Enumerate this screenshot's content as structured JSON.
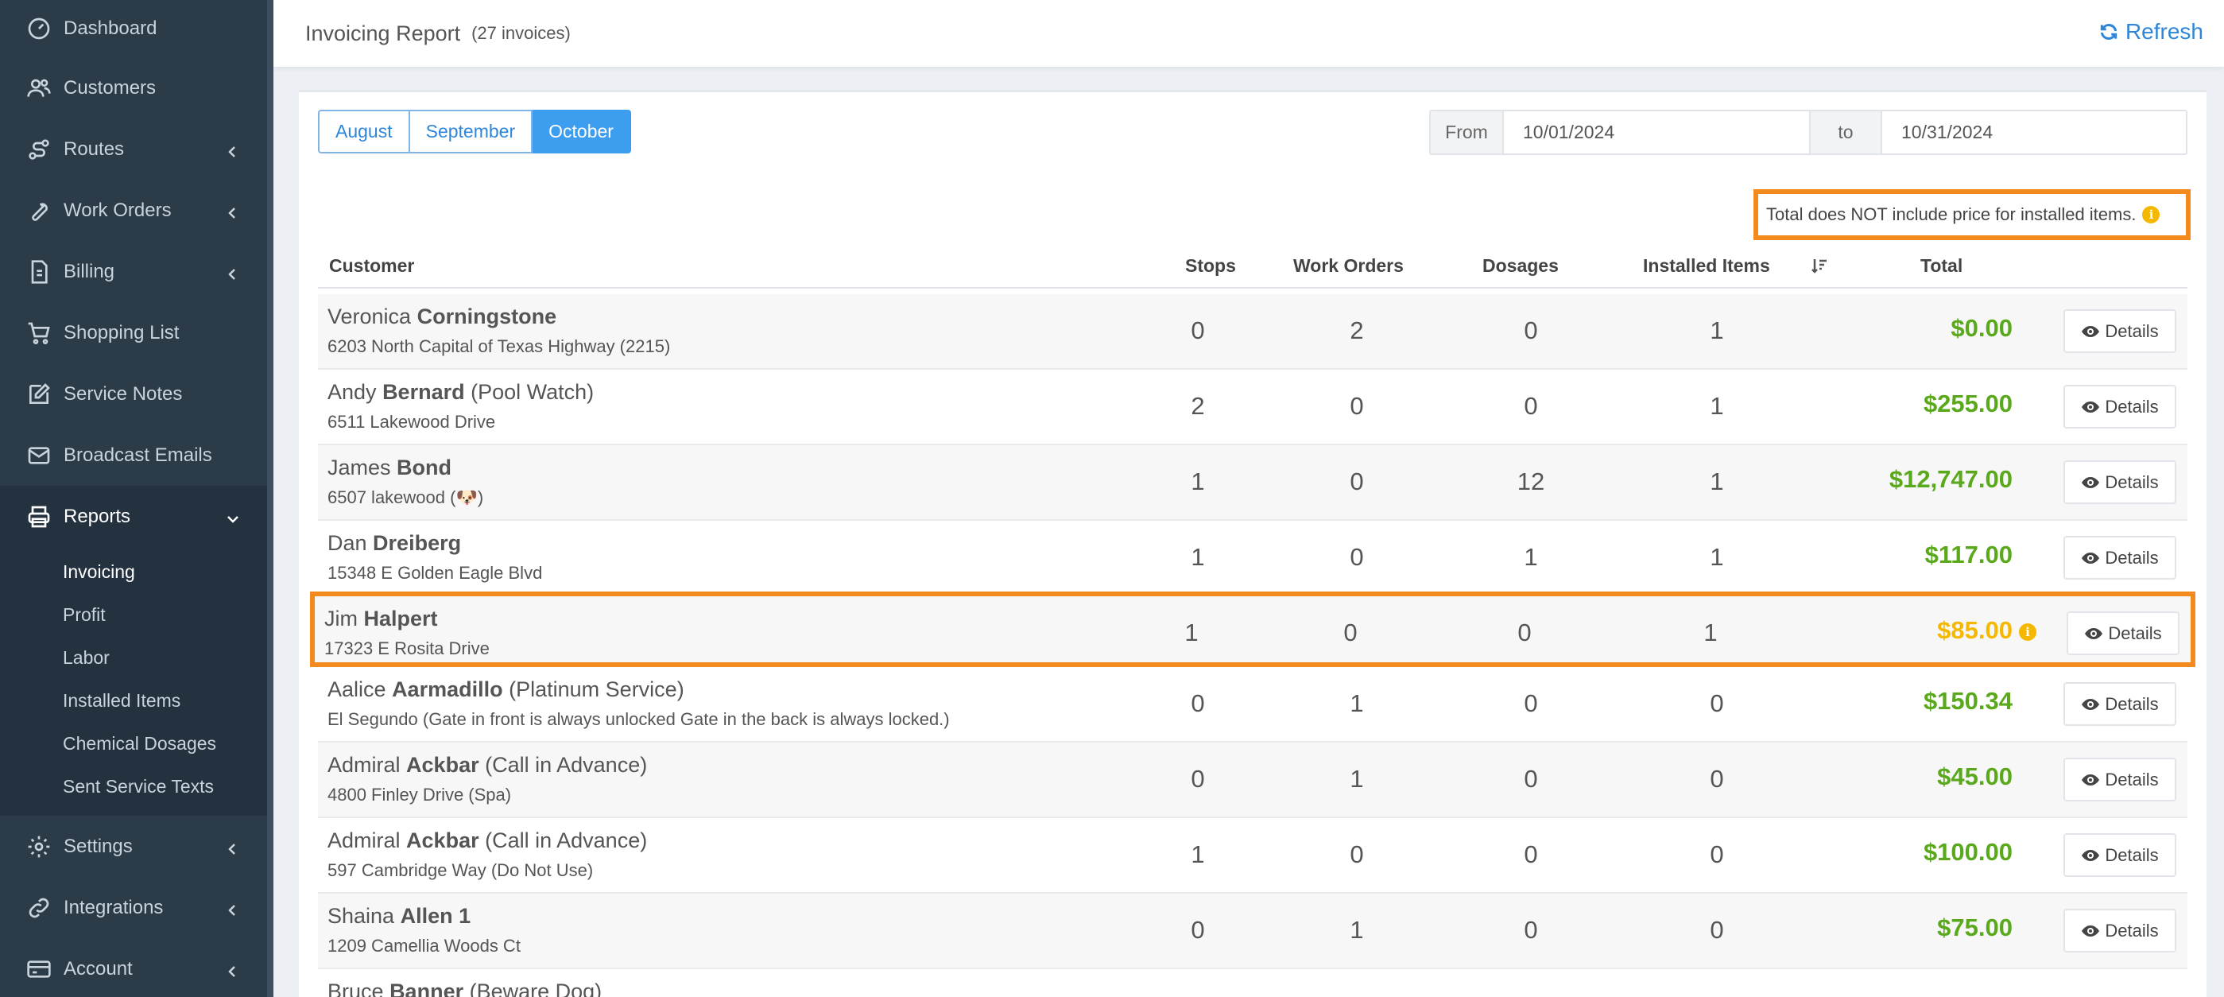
{
  "sidebar": {
    "items": [
      {
        "label": "Dashboard",
        "icon": "dashboard-icon"
      },
      {
        "label": "Customers",
        "icon": "users-icon"
      },
      {
        "label": "Routes",
        "icon": "route-icon"
      },
      {
        "label": "Work Orders",
        "icon": "wrench-icon"
      },
      {
        "label": "Billing",
        "icon": "invoice-icon"
      },
      {
        "label": "Shopping List",
        "icon": "cart-icon"
      },
      {
        "label": "Service Notes",
        "icon": "edit-icon"
      },
      {
        "label": "Broadcast Emails",
        "icon": "envelope-icon"
      },
      {
        "label": "Reports",
        "icon": "printer-icon"
      },
      {
        "label": "Settings",
        "icon": "gear-icon"
      },
      {
        "label": "Integrations",
        "icon": "link-icon"
      },
      {
        "label": "Account",
        "icon": "card-icon"
      }
    ],
    "reports_sub": [
      "Invoicing",
      "Profit",
      "Labor",
      "Installed Items",
      "Chemical Dosages",
      "Sent Service Texts"
    ]
  },
  "header": {
    "title": "Invoicing Report",
    "count": "(27 invoices)",
    "refresh_label": "Refresh"
  },
  "filters": {
    "months": [
      "August",
      "September",
      "October"
    ],
    "selected_month": "October",
    "from_label": "From",
    "from_value": "10/01/2024",
    "to_label": "to",
    "to_value": "10/31/2024"
  },
  "notice": "Total does NOT include price for installed items.",
  "table": {
    "columns": [
      "Customer",
      "Stops",
      "Work Orders",
      "Dosages",
      "Installed Items",
      "Total"
    ],
    "details_label": "Details",
    "rows": [
      {
        "first": "Veronica",
        "last": "Corningstone",
        "suffix": "",
        "address": "6203 North Capital of Texas Highway (2215)",
        "stops": "0",
        "work_orders": "2",
        "dosages": "0",
        "installed": "1",
        "total": "$0.00"
      },
      {
        "first": "Andy",
        "last": "Bernard",
        "suffix": "(Pool Watch)",
        "address": "6511 Lakewood Drive",
        "stops": "2",
        "work_orders": "0",
        "dosages": "0",
        "installed": "1",
        "total": "$255.00"
      },
      {
        "first": "James",
        "last": "Bond",
        "suffix": "",
        "address": "6507 lakewood (🐶)",
        "stops": "1",
        "work_orders": "0",
        "dosages": "12",
        "installed": "1",
        "total": "$12,747.00"
      },
      {
        "first": "Dan",
        "last": "Dreiberg",
        "suffix": "",
        "address": "15348 E Golden Eagle Blvd",
        "stops": "1",
        "work_orders": "0",
        "dosages": "1",
        "installed": "1",
        "total": "$117.00"
      },
      {
        "first": "Jim",
        "last": "Halpert",
        "suffix": "",
        "address": "17323 E Rosita Drive",
        "stops": "1",
        "work_orders": "0",
        "dosages": "0",
        "installed": "1",
        "total": "$85.00"
      },
      {
        "first": "Aalice",
        "last": "Aarmadillo",
        "suffix": "(Platinum Service)",
        "address": "El Segundo (Gate in front is always unlocked Gate in the back is always locked.)",
        "stops": "0",
        "work_orders": "1",
        "dosages": "0",
        "installed": "0",
        "total": "$150.34"
      },
      {
        "first": "Admiral",
        "last": "Ackbar",
        "suffix": "(Call in Advance)",
        "address": "4800 Finley Drive (Spa)",
        "stops": "0",
        "work_orders": "1",
        "dosages": "0",
        "installed": "0",
        "total": "$45.00"
      },
      {
        "first": "Admiral",
        "last": "Ackbar",
        "suffix": "(Call in Advance)",
        "address": "597 Cambridge Way (Do Not Use)",
        "stops": "1",
        "work_orders": "0",
        "dosages": "0",
        "installed": "0",
        "total": "$100.00"
      },
      {
        "first": "Shaina",
        "last": "Allen 1",
        "suffix": "",
        "address": "1209 Camellia Woods Ct",
        "stops": "0",
        "work_orders": "1",
        "dosages": "0",
        "installed": "0",
        "total": "$75.00"
      },
      {
        "first": "Bruce",
        "last": "Banner",
        "suffix": "(Beware Dog)",
        "address": "",
        "stops": "",
        "work_orders": "",
        "dosages": "",
        "installed": "",
        "total": ""
      }
    ]
  },
  "colors": {
    "sidebar_bg": "#2c3b48",
    "accent": "#3d9ef0",
    "total_green": "#5aa81c",
    "warning_yellow": "#f5b800",
    "highlight_orange": "#f28a1e"
  }
}
